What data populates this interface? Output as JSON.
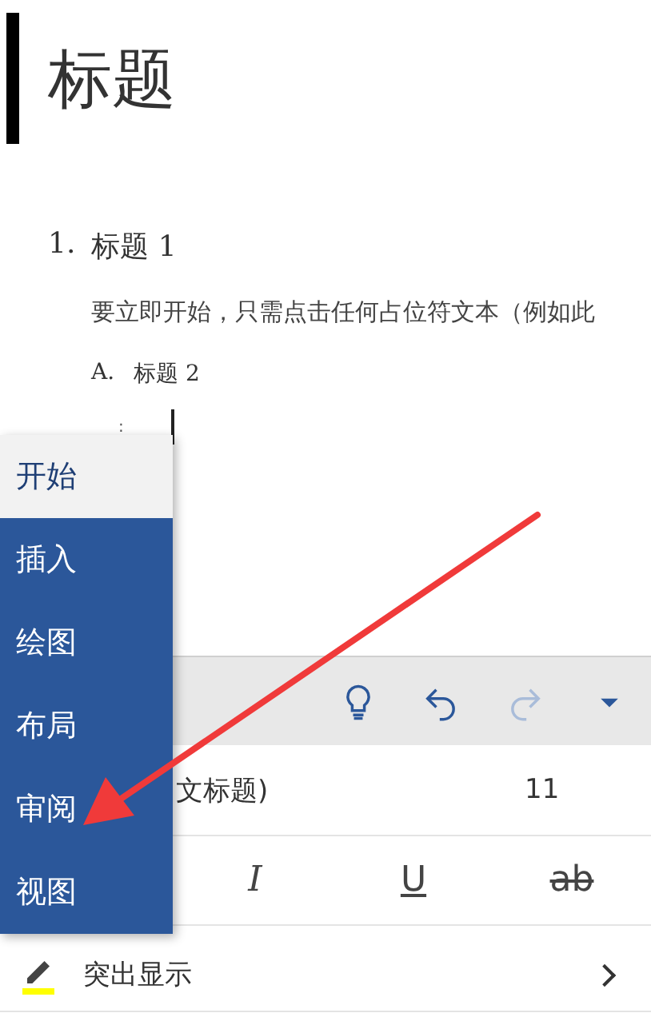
{
  "document": {
    "title": "标题",
    "heading_1": {
      "number": "1.",
      "text": "标题 1"
    },
    "body": "要立即开始，只需点击任何占位符文本（例如此",
    "heading_2": {
      "number": "A.",
      "text": "标题 2"
    },
    "list_marker": ":"
  },
  "menu": {
    "items": [
      {
        "label": "开始",
        "selected": true
      },
      {
        "label": "插入",
        "selected": false
      },
      {
        "label": "绘图",
        "selected": false
      },
      {
        "label": "布局",
        "selected": false
      },
      {
        "label": "审阅",
        "selected": false
      },
      {
        "label": "视图",
        "selected": false
      }
    ]
  },
  "toolbar": {
    "buttons": [
      {
        "kind": "lightbulb",
        "disabled": false
      },
      {
        "kind": "undo",
        "disabled": false
      },
      {
        "kind": "redo",
        "disabled": true
      },
      {
        "kind": "more",
        "disabled": false
      }
    ]
  },
  "style_row": {
    "style": "文标题)",
    "size": "11"
  },
  "format_buttons": [
    {
      "kind": "italic",
      "label": "I"
    },
    {
      "kind": "underline",
      "label": "U"
    },
    {
      "kind": "strikethrough",
      "label": "ab"
    }
  ],
  "highlight_row": {
    "label": "突出显示",
    "color": "#ffff00"
  }
}
